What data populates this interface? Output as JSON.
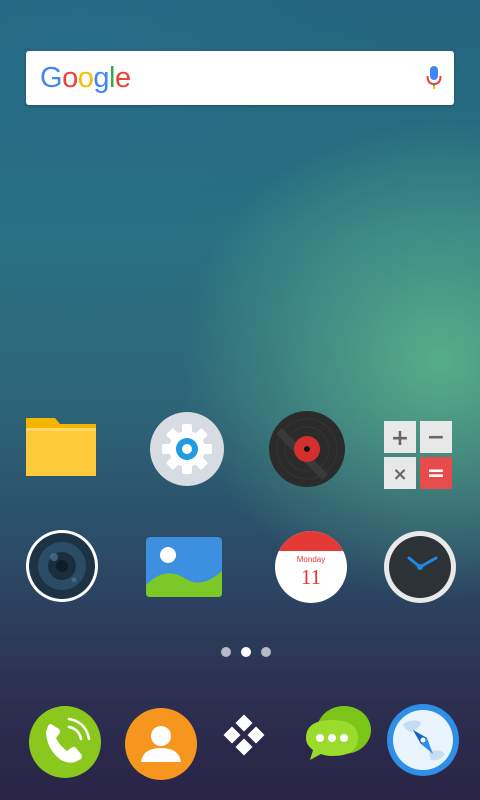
{
  "search": {
    "brand": "Google"
  },
  "apps": [
    {
      "icon": "folder-icon"
    },
    {
      "icon": "gear-icon"
    },
    {
      "icon": "vinyl-record-icon"
    },
    {
      "icon": "calculator-icon"
    },
    {
      "icon": "camera-lens-icon"
    },
    {
      "icon": "picture-icon"
    },
    {
      "icon": "calendar-icon"
    },
    {
      "icon": "clock-icon"
    }
  ],
  "calendar": {
    "weekday": "Monday",
    "day": "11"
  },
  "calculator": {
    "plus": "+",
    "minus": "−",
    "times": "×",
    "equals": "="
  },
  "page_indicator": {
    "pages": 3,
    "current": 2
  },
  "dock": [
    {
      "icon": "phone-icon"
    },
    {
      "icon": "contacts-icon"
    },
    {
      "icon": "app-drawer-icon"
    },
    {
      "icon": "messages-icon"
    },
    {
      "icon": "compass-icon"
    }
  ],
  "colors": {
    "google_blue": "#4285F4",
    "google_red": "#EA4335",
    "google_yellow": "#FBBC05",
    "google_green": "#34A853"
  }
}
